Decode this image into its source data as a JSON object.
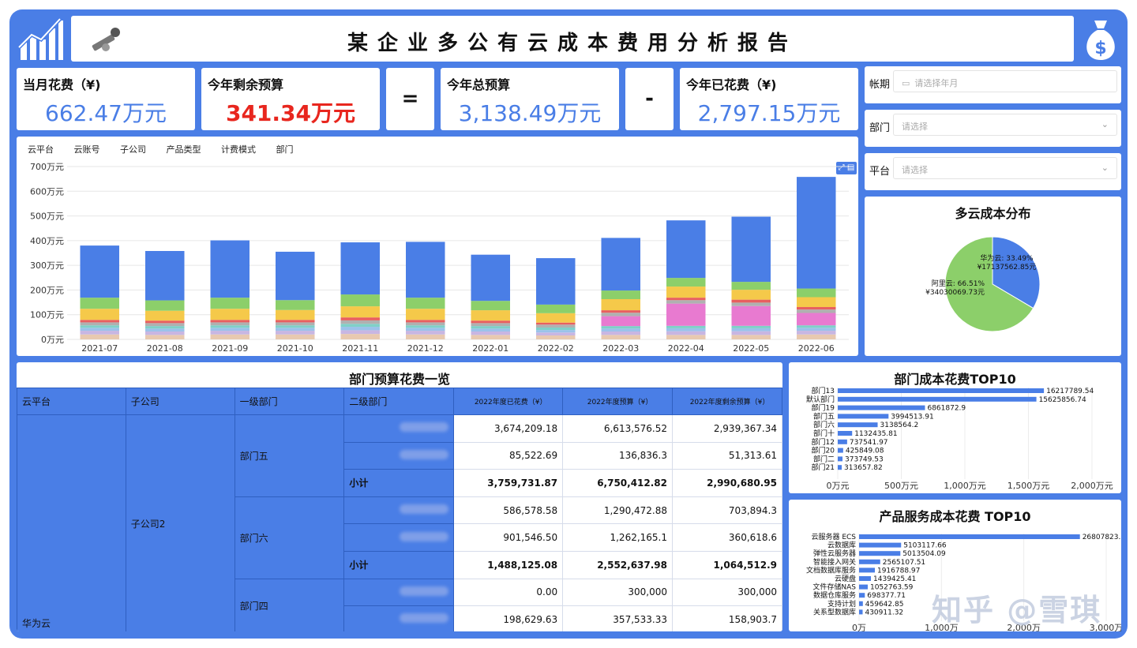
{
  "header": {
    "title": "某企业多公有云成本费用分析报告"
  },
  "kpis": {
    "monthly": {
      "label": "当月花费（¥)",
      "value": "662.47万元",
      "color": "#4a7ee6"
    },
    "remaining": {
      "label": "今年剩余预算",
      "value": "341.34万元",
      "color": "#e8261e"
    },
    "equals": "=",
    "total": {
      "label": "今年总预算",
      "value": "3,138.49万元",
      "color": "#4a7ee6"
    },
    "minus": "-",
    "spent": {
      "label": "今年已花费（¥)",
      "value": "2,797.15万元",
      "color": "#4a7ee6"
    }
  },
  "filters": [
    {
      "label": "帐期",
      "placeholder": "请选择年月",
      "icon": "calendar-icon"
    },
    {
      "label": "部门",
      "placeholder": "请选择",
      "icon": "chevron-down-icon"
    },
    {
      "label": "平台",
      "placeholder": "请选择",
      "icon": "chevron-down-icon"
    }
  ],
  "chart_tabs": [
    "云平台",
    "云账号",
    "子公司",
    "产品类型",
    "计费模式",
    "部门"
  ],
  "chart_data": [
    {
      "type": "bar",
      "stacked": true,
      "categories": [
        "2021-07",
        "2021-08",
        "2021-09",
        "2021-10",
        "2021-11",
        "2021-12",
        "2022-01",
        "2022-02",
        "2022-03",
        "2022-04",
        "2022-05",
        "2022-06"
      ],
      "ytick_labels": [
        "0万元",
        "100万元",
        "200万元",
        "300万元",
        "400万元",
        "500万元",
        "600万元",
        "700万元"
      ],
      "ylim": [
        0,
        700
      ],
      "grid": true,
      "series": [
        {
          "color": "#e8c9b0",
          "values": [
            20,
            18,
            20,
            20,
            22,
            20,
            18,
            16,
            18,
            18,
            18,
            20
          ]
        },
        {
          "color": "#c8b6e2",
          "values": [
            15,
            14,
            15,
            15,
            15,
            15,
            14,
            12,
            14,
            15,
            15,
            15
          ]
        },
        {
          "color": "#9bc2ea",
          "values": [
            12,
            12,
            12,
            12,
            14,
            12,
            12,
            10,
            12,
            12,
            12,
            12
          ]
        },
        {
          "color": "#7fd0c8",
          "values": [
            10,
            10,
            10,
            10,
            12,
            10,
            10,
            10,
            10,
            10,
            10,
            10
          ]
        },
        {
          "color": "#e87ad0",
          "values": [
            0,
            0,
            0,
            0,
            0,
            0,
            0,
            0,
            40,
            90,
            80,
            50
          ]
        },
        {
          "color": "#b0b0b0",
          "values": [
            12,
            12,
            12,
            12,
            14,
            12,
            12,
            12,
            14,
            14,
            14,
            14
          ]
        },
        {
          "color": "#e85f5f",
          "values": [
            10,
            10,
            10,
            10,
            12,
            10,
            10,
            8,
            10,
            10,
            12,
            10
          ]
        },
        {
          "color": "#f5c94a",
          "values": [
            45,
            40,
            45,
            40,
            45,
            45,
            42,
            38,
            45,
            45,
            40,
            40
          ]
        },
        {
          "color": "#8ccf6a",
          "values": [
            45,
            42,
            45,
            40,
            48,
            45,
            38,
            35,
            35,
            35,
            32,
            35
          ]
        },
        {
          "color": "#4a7ee6",
          "values": [
            211,
            200,
            232,
            196,
            211,
            226,
            187,
            188,
            213,
            233,
            264,
            452
          ]
        }
      ]
    },
    {
      "type": "pie",
      "title": "多云成本分布",
      "slices": [
        {
          "name": "华为云",
          "percent": 33.49,
          "value": "¥17137562.85",
          "color": "#4a7ee6"
        },
        {
          "name": "阿里云",
          "percent": 66.51,
          "value": "¥34030069.73",
          "color": "#8ccf6a"
        }
      ],
      "labels": [
        "华为云: 33.49%",
        "¥17137562.85元",
        "阿里云: 66.51%",
        "¥34030069.73元"
      ]
    },
    {
      "type": "bar",
      "orientation": "horizontal",
      "title": "部门成本花费TOP10",
      "categories": [
        "部门13",
        "默认部门",
        "部门19",
        "部门五",
        "部门六",
        "部门十",
        "部门12",
        "部门20",
        "部门二",
        "部门21"
      ],
      "values": [
        16217789.54,
        15625856.74,
        6861872.9,
        3994513.91,
        3138564.2,
        1132435.81,
        737541.97,
        425849.08,
        373749.53,
        313657.82
      ],
      "value_labels": [
        "16217789.54",
        "15625856.74",
        "6861872.9",
        "3994513.91",
        "3138564.2",
        "1132435.81",
        "737541.97",
        "425849.08",
        "373749.53",
        "313657.82"
      ],
      "xlim": [
        0,
        20000000
      ],
      "xtick_labels": [
        "0万元",
        "500万元",
        "1,000万元",
        "1,500万元",
        "2,000万元"
      ]
    },
    {
      "type": "bar",
      "orientation": "horizontal",
      "title": "产品服务成本花费 TOP10",
      "categories": [
        "云服务器 ECS",
        "云数据库",
        "弹性云服务器",
        "智能接入网关",
        "文档数据库服务",
        "云硬盘",
        "文件存储NAS",
        "数据仓库服务",
        "支持计划",
        "关系型数据库"
      ],
      "values": [
        26807823.55,
        5103117.66,
        5013504.09,
        2565107.51,
        1916788.97,
        1439425.41,
        1052763.59,
        698377.71,
        459642.85,
        430911.32
      ],
      "value_labels": [
        "26807823.55",
        "5103117.66",
        "5013504.09",
        "2565107.51",
        "1916788.97",
        "1439425.41",
        "1052763.59",
        "698377.71",
        "459642.85",
        "430911.32"
      ],
      "xlim": [
        0,
        30000000
      ],
      "xtick_labels": [
        "0万",
        "1,000万",
        "2,000万",
        "3,000万"
      ]
    }
  ],
  "dept_table": {
    "title": "部门预算花费一览",
    "headers": [
      "云平台",
      "子公司",
      "一级部门",
      "二级部门",
      "2022年度已花费（¥）",
      "2022年度预算（¥）",
      "2022年度剩余预算（¥）"
    ],
    "platform": "华为云",
    "company": "子公司2",
    "dept_a": "部门五",
    "dept_b": "部门六",
    "dept_c": "部门四",
    "subtotal": "小计",
    "rows": [
      [
        "3,674,209.18",
        "6,613,576.52",
        "2,939,367.34"
      ],
      [
        "85,522.69",
        "136,836.3",
        "51,313.61"
      ],
      [
        "3,759,731.87",
        "6,750,412.82",
        "2,990,680.95"
      ],
      [
        "586,578.58",
        "1,290,472.88",
        "703,894.3"
      ],
      [
        "901,546.50",
        "1,262,165.1",
        "360,618.6"
      ],
      [
        "1,488,125.08",
        "2,552,637.98",
        "1,064,512.9"
      ],
      [
        "0.00",
        "300,000",
        "300,000"
      ],
      [
        "198,629.63",
        "357,533.33",
        "158,903.7"
      ]
    ]
  },
  "watermark": "知乎 @雪琪"
}
